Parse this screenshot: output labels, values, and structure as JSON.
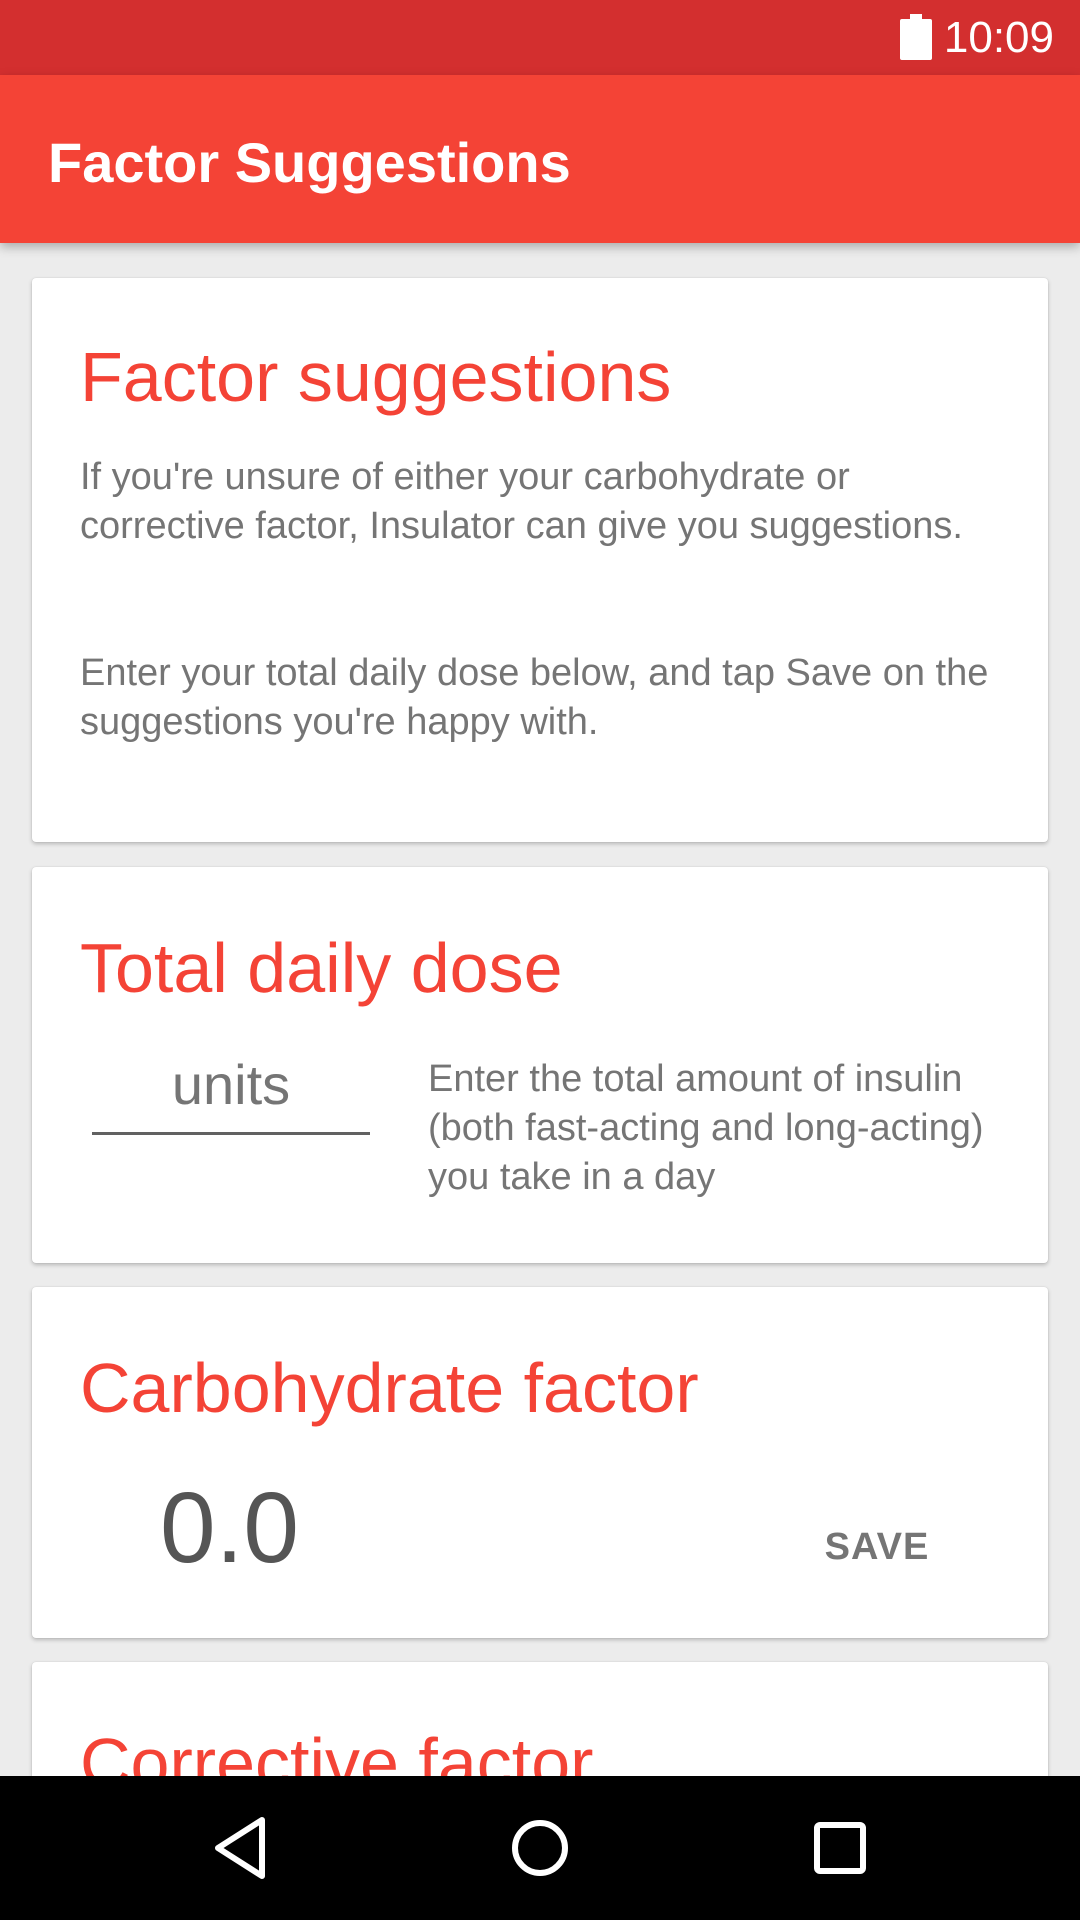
{
  "status_bar": {
    "time": "10:09",
    "icons": [
      "battery-icon"
    ]
  },
  "app_bar": {
    "title": "Factor Suggestions"
  },
  "cards": {
    "intro": {
      "title": "Factor suggestions",
      "paragraph1": "If you're unsure of either your carbohydrate or corrective factor, Insulator can give you suggestions.",
      "paragraph2": "Enter your total daily dose below, and tap Save on the suggestions you're happy with."
    },
    "total_daily_dose": {
      "title": "Total daily dose",
      "input_value": "",
      "input_placeholder": "units",
      "help_text": "Enter the total amount of insulin (both fast-acting and long-acting) you take in a day"
    },
    "carbohydrate_factor": {
      "title": "Carbohydrate factor",
      "value": "0.0",
      "save_label": "SAVE"
    },
    "corrective_factor": {
      "title": "Corrective factor"
    }
  },
  "nav_bar": {
    "icons": [
      "back-icon",
      "home-icon",
      "recents-icon"
    ]
  },
  "colors": {
    "status_bar": "#d32f2f",
    "app_bar": "#f44336",
    "accent_text": "#f44336",
    "body_text": "#757575",
    "background": "#ececec"
  }
}
